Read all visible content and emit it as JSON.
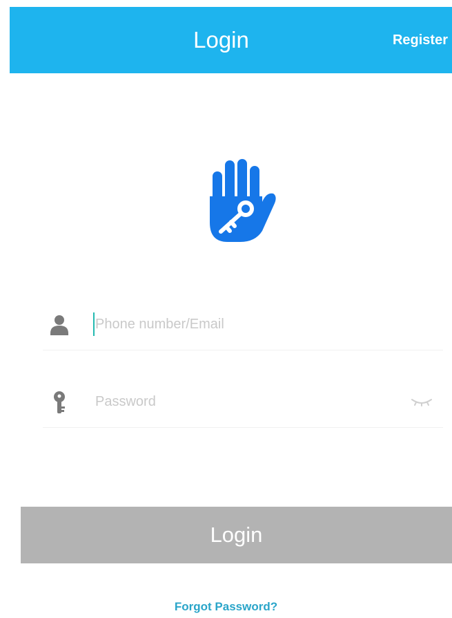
{
  "header": {
    "title": "Login",
    "register_label": "Register"
  },
  "logo": {
    "icon": "hand-key-icon",
    "color": "#1677e8"
  },
  "form": {
    "phone": {
      "placeholder": "Phone number/Email",
      "value": "",
      "icon": "user-icon"
    },
    "password": {
      "placeholder": "Password",
      "value": "",
      "icon": "key-icon",
      "toggle_icon": "eye-closed-icon"
    }
  },
  "actions": {
    "login_label": "Login",
    "forgot_label": "Forgot Password?"
  },
  "colors": {
    "header_bg": "#1eb4ee",
    "button_bg": "#b3b3b3",
    "link": "#2aa5c9"
  }
}
